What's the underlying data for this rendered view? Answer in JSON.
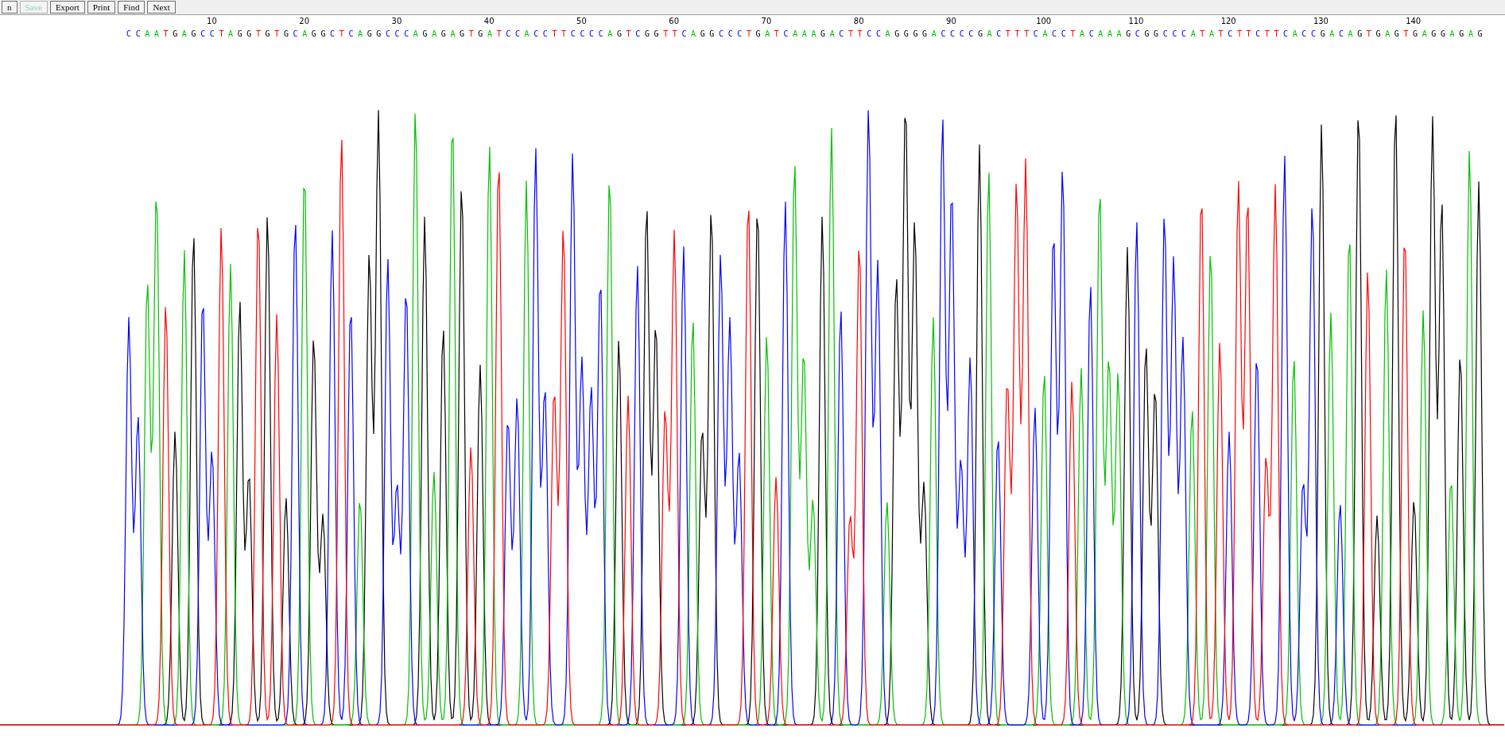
{
  "toolbar": {
    "buttons": [
      {
        "label": "n",
        "disabled": false
      },
      {
        "label": "Save",
        "disabled": true
      },
      {
        "label": "Export",
        "disabled": false
      },
      {
        "label": "Print",
        "disabled": false
      },
      {
        "label": "Find",
        "disabled": false
      },
      {
        "label": "Next",
        "disabled": false
      }
    ]
  },
  "ruler": {
    "labels": [
      "10",
      "20",
      "30",
      "40",
      "50",
      "60",
      "70",
      "80",
      "90",
      "100",
      "110",
      "120",
      "130",
      "140"
    ]
  },
  "sequence": "CCAATGAGCCTAGGTGTGCAGGCTCAGGCCCAGAGAGTGATCCACCTTCCCCAGTCGGTTCAGGCCCTGATCAAAGACTTCCAGGGGACCCCGACTTTCACCTACAAAGCGGCCCATATCTTCTTCACCGACAGTGAGTGAGGAGAG"
}
